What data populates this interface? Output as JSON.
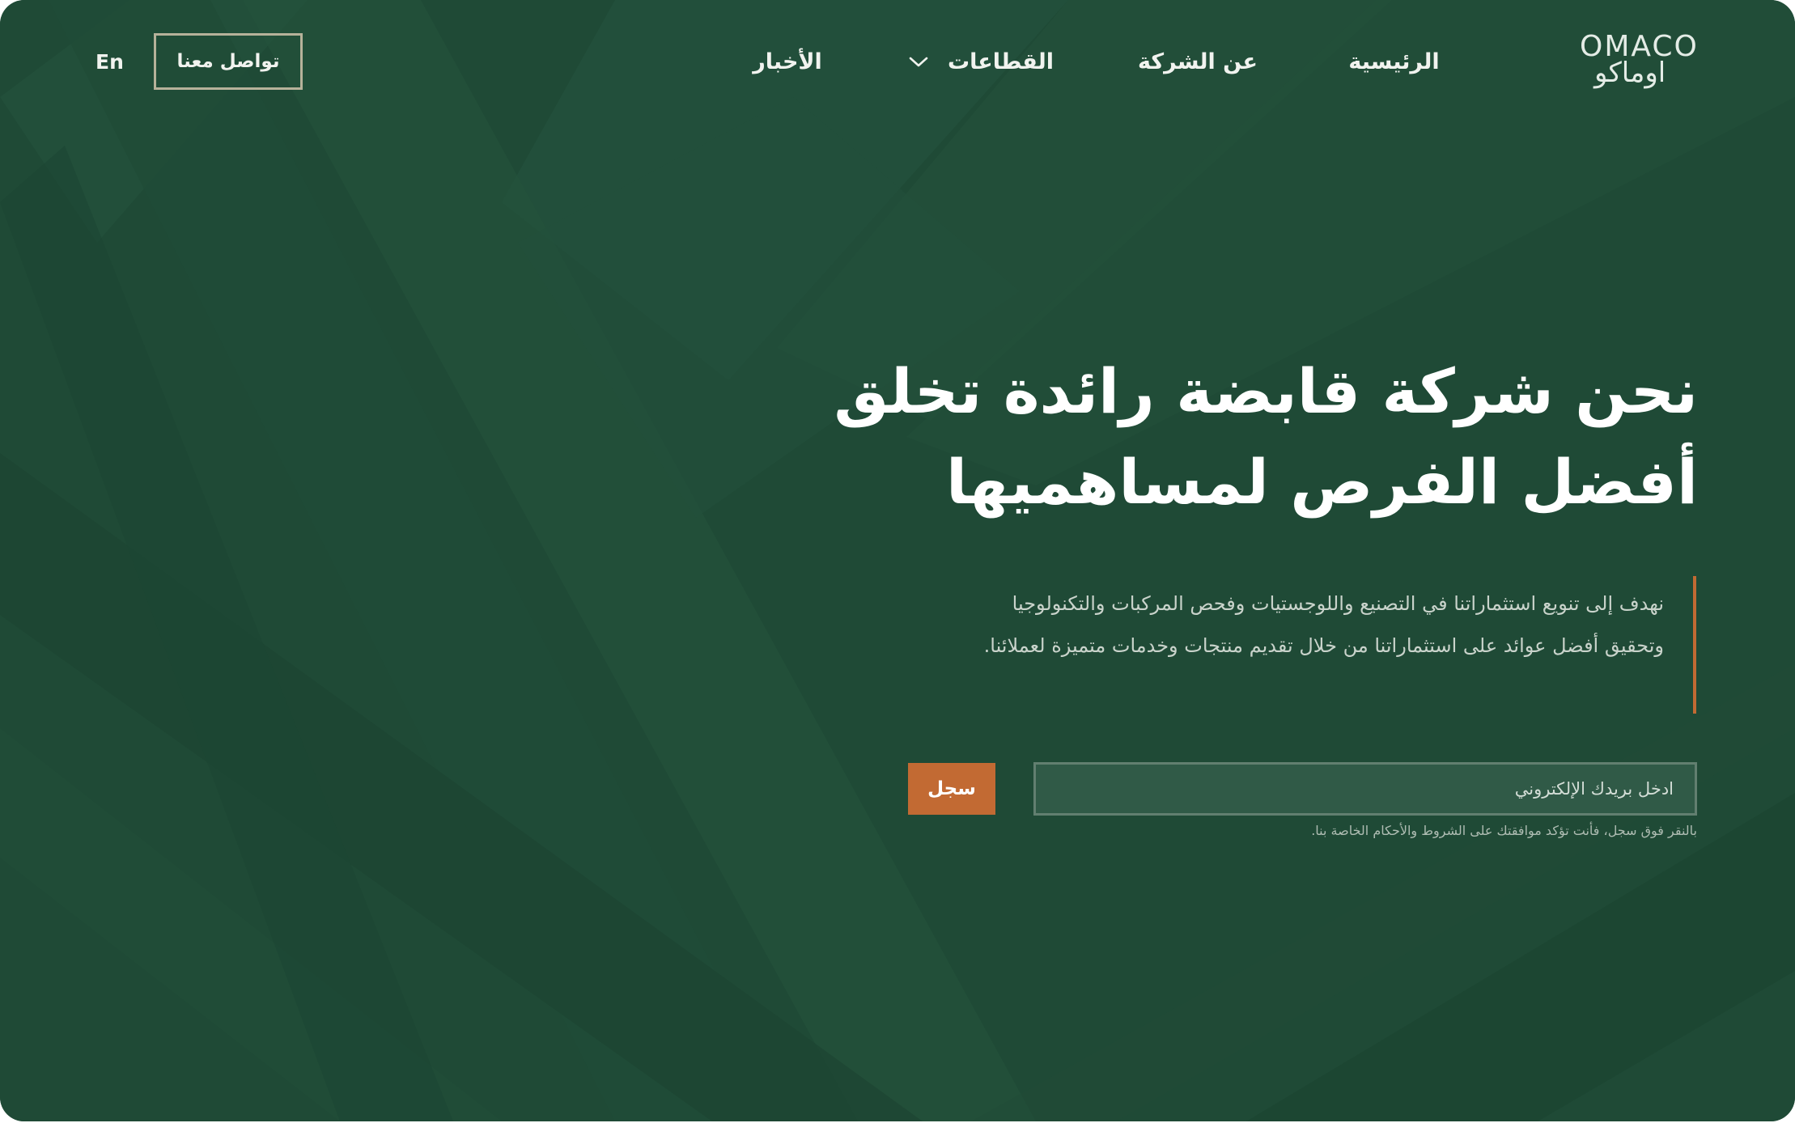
{
  "colors": {
    "background": "#1f4a36",
    "accent": "#c26a33",
    "text": "#ffffff",
    "muted_text": "#c9d3cb"
  },
  "header": {
    "logo": {
      "latin": "OMACO",
      "arabic": "اوماكو"
    },
    "nav": {
      "home": "الرئيسية",
      "about": "عن الشركة",
      "sectors": "القطاعات",
      "news": "الأخبار"
    },
    "contact_label": "تواصل معنا",
    "language_label": "En"
  },
  "hero": {
    "title": "نحن شركة قابضة رائدة تخلق أفضل الفرص لمساهميها",
    "description": "نهدف إلى تنويع استثماراتنا في التصنيع واللوجستيات وفحص المركبات والتكنولوجيا وتحقيق أفضل عوائد على استثماراتنا من خلال تقديم منتجات وخدمات متميزة لعملائنا.",
    "email_placeholder": "ادخل بريدك الإلكتروني",
    "submit_label": "سجل",
    "terms_note": "بالنقر فوق سجل، فأنت تؤكد موافقتك على الشروط والأحكام الخاصة بنا."
  },
  "icons": {
    "sectors_dropdown": "chevron-down-icon"
  }
}
